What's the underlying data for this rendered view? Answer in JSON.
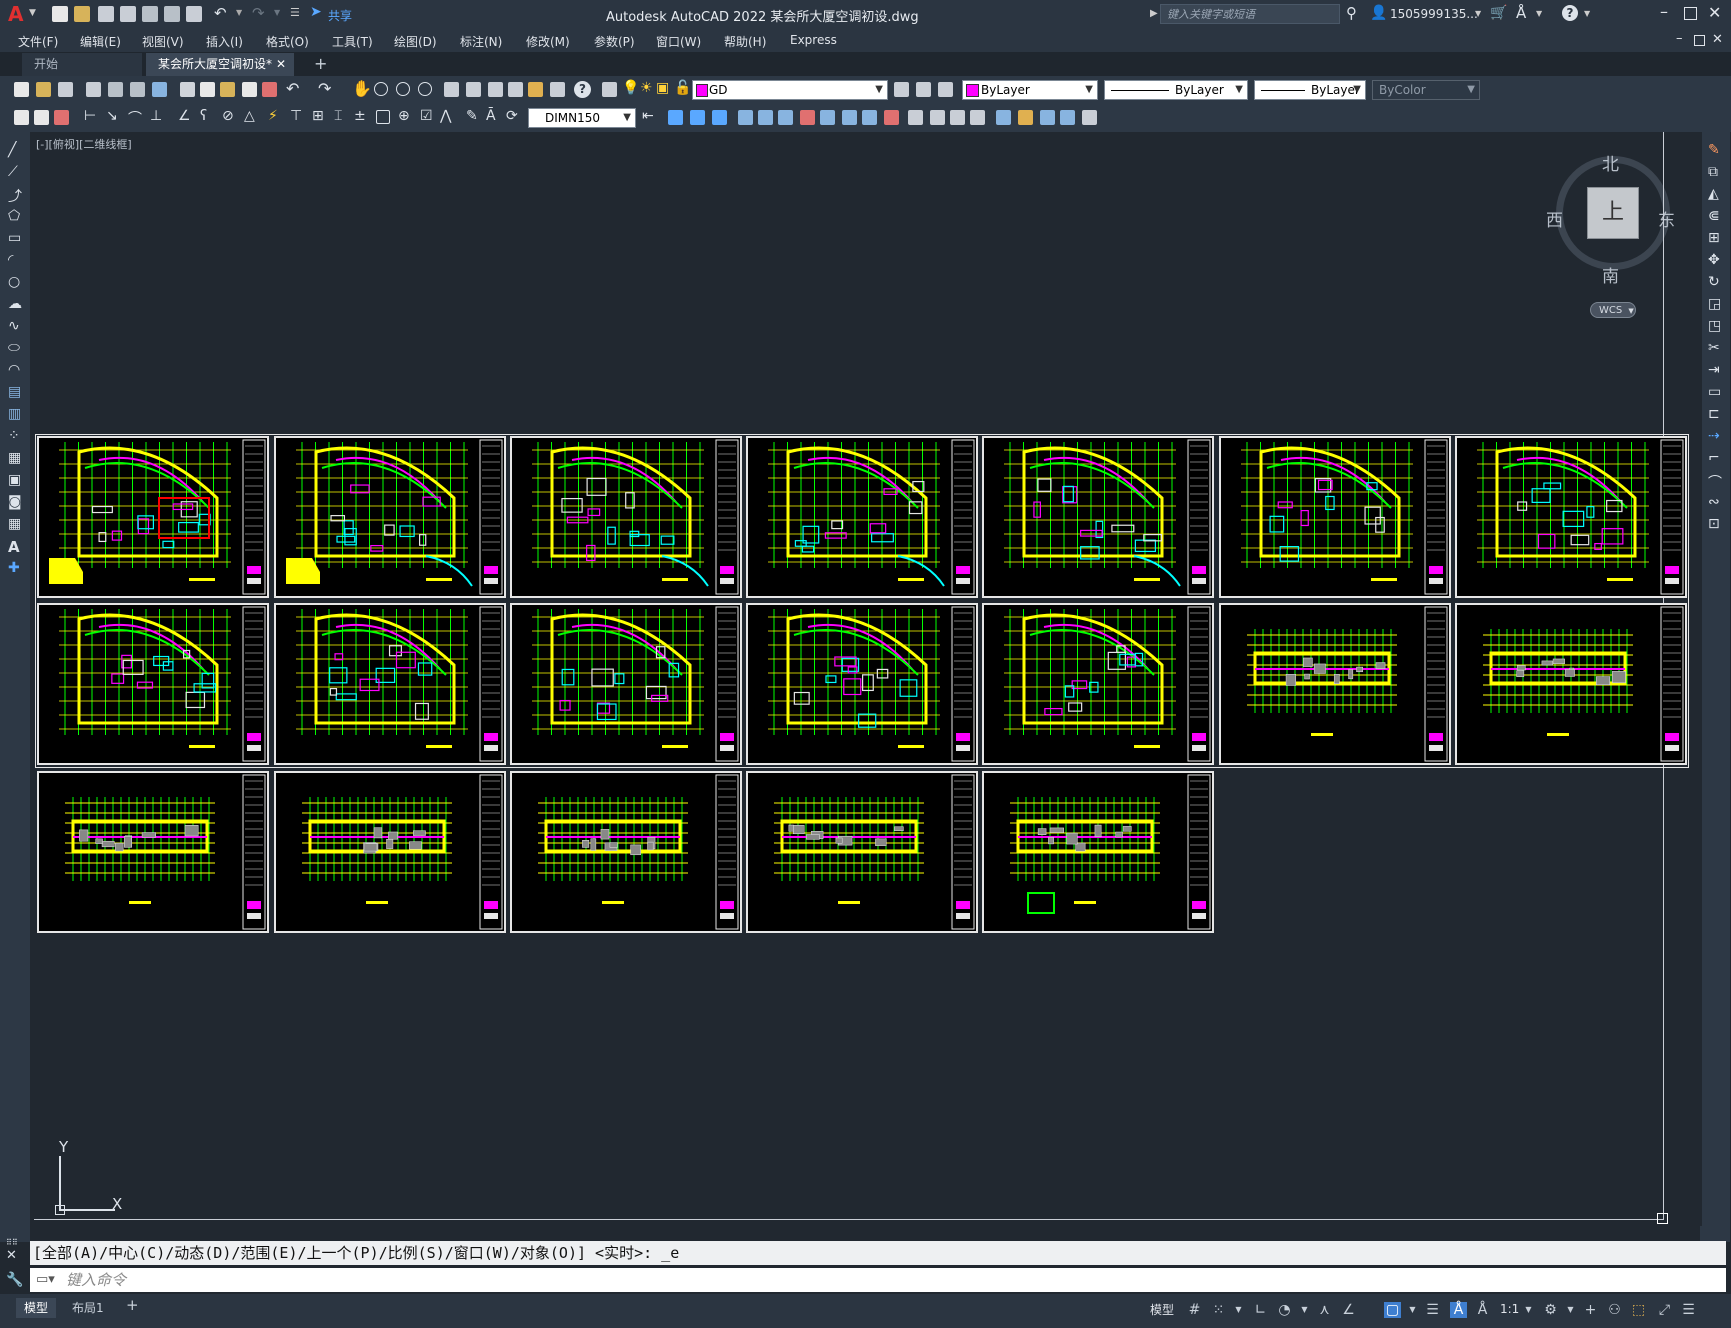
{
  "app": {
    "title": "Autodesk AutoCAD 2022    某会所大厦空调初设.dwg",
    "share_label": "共享",
    "search_placeholder": "键入关键字或短语",
    "user": "1505999135...",
    "logo_letter": "A"
  },
  "menu": [
    "文件(F)",
    "编辑(E)",
    "视图(V)",
    "插入(I)",
    "格式(O)",
    "工具(T)",
    "绘图(D)",
    "标注(N)",
    "修改(M)",
    "参数(P)",
    "窗口(W)",
    "帮助(H)",
    "Express"
  ],
  "tabs": [
    {
      "label": "开始",
      "active": false
    },
    {
      "label": "某会所大厦空调初设*",
      "active": true
    }
  ],
  "properties": {
    "layer": "GD",
    "color": "ByLayer",
    "linetype": "ByLayer",
    "lineweight": "ByLayer",
    "plotstyle": "ByColor",
    "dimstyle": "DIMN150",
    "layer_color_hex": "#ff00ff"
  },
  "viewport": {
    "label": "[-][俯视][二维线框]",
    "viewcube": {
      "north": "北",
      "south": "南",
      "east": "东",
      "west": "西",
      "face": "上",
      "wcs": "WCS"
    },
    "ucs": {
      "x": "X",
      "y": "Y"
    }
  },
  "command": {
    "history": "[全部(A)/中心(C)/动态(D)/范围(E)/上一个(P)/比例(S)/窗口(W)/对象(O)] <实时>: _e",
    "placeholder": "键入命令"
  },
  "layout_tabs": [
    "模型",
    "布局1"
  ],
  "status": {
    "model_label": "模型",
    "scale": "1:1"
  },
  "colors": {
    "drawing_green": "#00ff00",
    "drawing_yellow": "#ffff00",
    "drawing_magenta": "#ff00ff",
    "drawing_cyan": "#00ffff",
    "drawing_red": "#ff0000"
  }
}
